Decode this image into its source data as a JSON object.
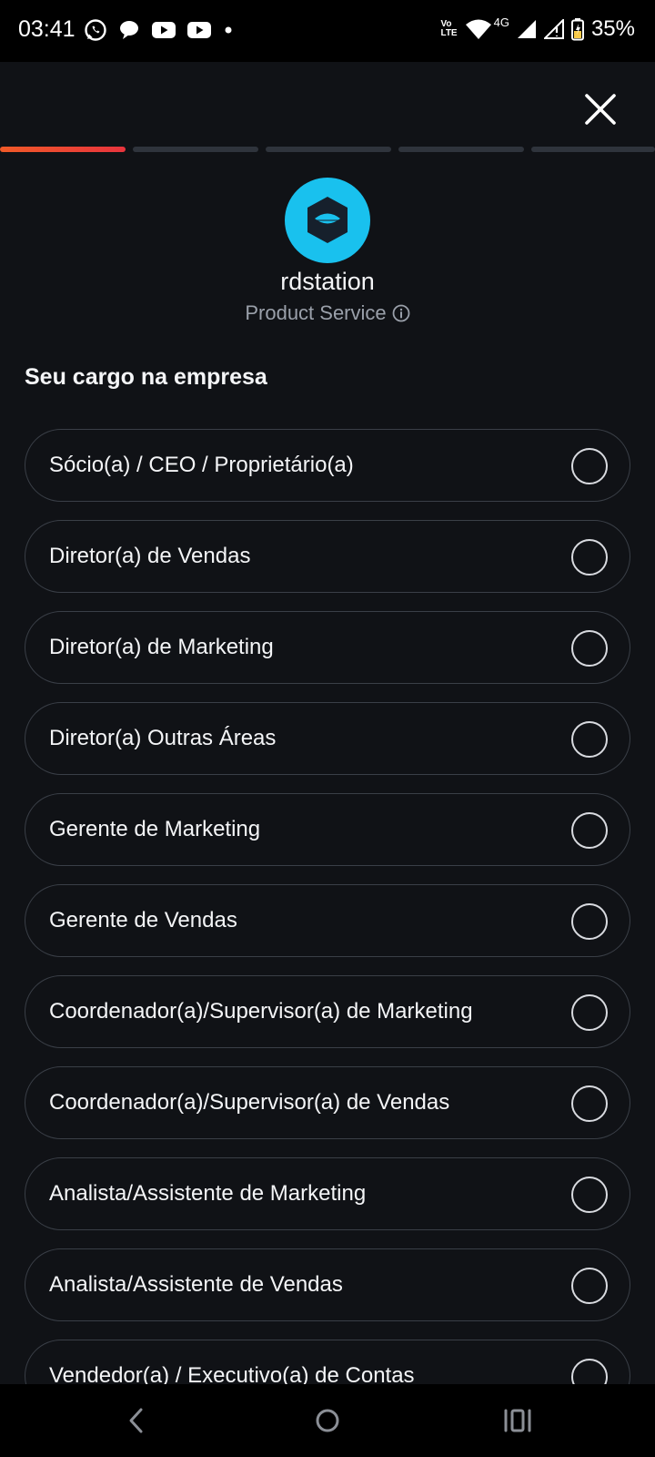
{
  "status_bar": {
    "time": "03:41",
    "notification_icons": [
      "whatsapp-icon",
      "chat-icon",
      "youtube-icon",
      "youtube-icon",
      "dot-icon"
    ],
    "network": "4G",
    "volte": "Vo LTE",
    "battery": "35%"
  },
  "colors": {
    "background": "#101216",
    "accent": "#f05a28",
    "logo": "#19c1ee"
  },
  "progress": {
    "total_steps": 5,
    "current_step": 1
  },
  "brand": {
    "name": "rdstation",
    "subtitle": "Product Service"
  },
  "section_title": "Seu cargo na empresa",
  "options": [
    {
      "label": "Sócio(a) / CEO / Proprietário(a)",
      "selected": false
    },
    {
      "label": "Diretor(a) de Vendas",
      "selected": false
    },
    {
      "label": "Diretor(a) de Marketing",
      "selected": false
    },
    {
      "label": "Diretor(a) Outras Áreas",
      "selected": false
    },
    {
      "label": "Gerente de Marketing",
      "selected": false
    },
    {
      "label": "Gerente de Vendas",
      "selected": false
    },
    {
      "label": "Coordenador(a)/Supervisor(a) de Marketing",
      "selected": false
    },
    {
      "label": "Coordenador(a)/Supervisor(a) de Vendas",
      "selected": false
    },
    {
      "label": "Analista/Assistente de Marketing",
      "selected": false
    },
    {
      "label": "Analista/Assistente de Vendas",
      "selected": false
    },
    {
      "label": "Vendedor(a) / Executivo(a) de Contas",
      "selected": false
    }
  ],
  "nav_bar": [
    "back-icon",
    "home-icon",
    "recents-icon"
  ]
}
